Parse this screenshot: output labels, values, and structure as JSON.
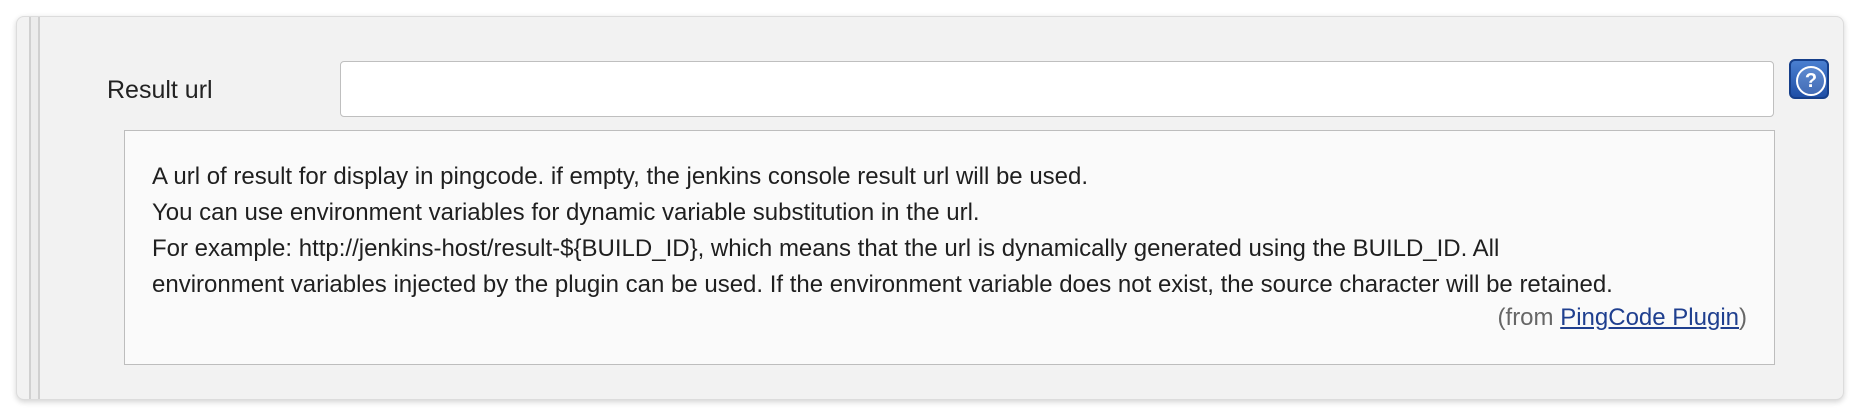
{
  "field": {
    "label": "Result url",
    "value": "",
    "placeholder": ""
  },
  "help_button": {
    "icon": "question-mark-icon",
    "glyph": "?"
  },
  "help": {
    "lines": [
      "A url of result for display in pingcode. if empty, the jenkins console result url will be used.",
      "You can use environment variables for dynamic variable substitution in the url.",
      "For example: http://jenkins-host/result-${BUILD_ID}, which means that the url is dynamically generated using the BUILD_ID. All",
      "environment variables injected by the plugin can be used. If the environment variable does not exist, the source character will be retained."
    ],
    "from_prefix": "(from ",
    "plugin_link": "PingCode Plugin",
    "from_suffix": ")"
  },
  "colors": {
    "panel_background": "#f2f2f2",
    "help_background": "#fafafa",
    "link": "#1f3f8f",
    "help_button": "#1f4fa6"
  }
}
